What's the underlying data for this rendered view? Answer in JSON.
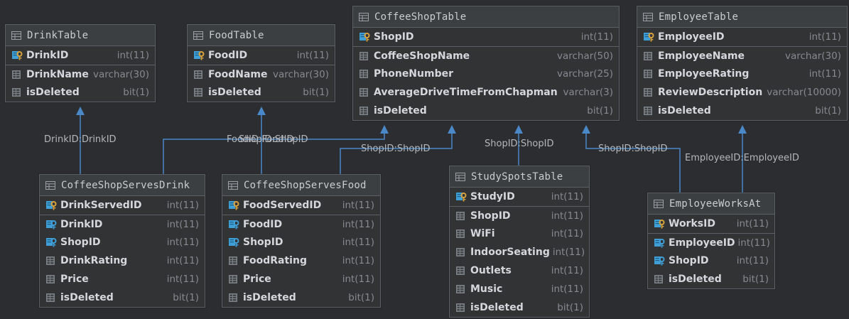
{
  "tables": {
    "drink": {
      "name": "DrinkTable",
      "pk": [
        {
          "name": "DrinkID",
          "type": "int(11)",
          "icon": "primary-key-icon"
        }
      ],
      "cols": [
        {
          "name": "DrinkName",
          "type": "varchar(30)",
          "icon": "column-icon"
        },
        {
          "name": "isDeleted",
          "type": "bit(1)",
          "icon": "column-icon"
        }
      ]
    },
    "food": {
      "name": "FoodTable",
      "pk": [
        {
          "name": "FoodID",
          "type": "int(11)",
          "icon": "primary-key-icon"
        }
      ],
      "cols": [
        {
          "name": "FoodName",
          "type": "varchar(30)",
          "icon": "column-icon"
        },
        {
          "name": "isDeleted",
          "type": "bit(1)",
          "icon": "column-icon"
        }
      ]
    },
    "coffeeshop": {
      "name": "CoffeeShopTable",
      "pk": [
        {
          "name": "ShopID",
          "type": "int(11)",
          "icon": "primary-key-icon"
        }
      ],
      "cols": [
        {
          "name": "CoffeeShopName",
          "type": "varchar(50)",
          "icon": "column-icon"
        },
        {
          "name": "PhoneNumber",
          "type": "varchar(25)",
          "icon": "column-icon"
        },
        {
          "name": "AverageDriveTimeFromChapman",
          "type": "varchar(3)",
          "icon": "column-icon"
        },
        {
          "name": "isDeleted",
          "type": "bit(1)",
          "icon": "column-icon"
        }
      ]
    },
    "employee": {
      "name": "EmployeeTable",
      "pk": [
        {
          "name": "EmployeeID",
          "type": "int(11)",
          "icon": "primary-key-icon"
        }
      ],
      "cols": [
        {
          "name": "EmployeeName",
          "type": "varchar(30)",
          "icon": "column-icon"
        },
        {
          "name": "EmployeeRating",
          "type": "int(11)",
          "icon": "column-icon"
        },
        {
          "name": "ReviewDescription",
          "type": "varchar(10000)",
          "icon": "column-icon"
        },
        {
          "name": "isDeleted",
          "type": "bit(1)",
          "icon": "column-icon"
        }
      ]
    },
    "servesdrink": {
      "name": "CoffeeShopServesDrink",
      "pk": [
        {
          "name": "DrinkServedID",
          "type": "int(11)",
          "icon": "primary-key-icon"
        }
      ],
      "cols": [
        {
          "name": "DrinkID",
          "type": "int(11)",
          "icon": "foreign-key-icon"
        },
        {
          "name": "ShopID",
          "type": "int(11)",
          "icon": "foreign-key-icon"
        },
        {
          "name": "DrinkRating",
          "type": "int(11)",
          "icon": "column-icon"
        },
        {
          "name": "Price",
          "type": "int(11)",
          "icon": "column-icon"
        },
        {
          "name": "isDeleted",
          "type": "bit(1)",
          "icon": "column-icon"
        }
      ]
    },
    "servesfood": {
      "name": "CoffeeShopServesFood",
      "pk": [
        {
          "name": "FoodServedID",
          "type": "int(11)",
          "icon": "primary-key-icon"
        }
      ],
      "cols": [
        {
          "name": "FoodID",
          "type": "int(11)",
          "icon": "foreign-key-icon"
        },
        {
          "name": "ShopID",
          "type": "int(11)",
          "icon": "foreign-key-icon"
        },
        {
          "name": "FoodRating",
          "type": "int(11)",
          "icon": "column-icon"
        },
        {
          "name": "Price",
          "type": "int(11)",
          "icon": "column-icon"
        },
        {
          "name": "isDeleted",
          "type": "bit(1)",
          "icon": "column-icon"
        }
      ]
    },
    "studyspots": {
      "name": "StudySpotsTable",
      "pk": [
        {
          "name": "StudyID",
          "type": "int(11)",
          "icon": "primary-key-icon"
        }
      ],
      "cols": [
        {
          "name": "ShopID",
          "type": "int(11)",
          "icon": "column-icon"
        },
        {
          "name": "WiFi",
          "type": "int(11)",
          "icon": "column-icon"
        },
        {
          "name": "IndoorSeating",
          "type": "int(11)",
          "icon": "column-icon"
        },
        {
          "name": "Outlets",
          "type": "int(11)",
          "icon": "column-icon"
        },
        {
          "name": "Music",
          "type": "int(11)",
          "icon": "column-icon"
        },
        {
          "name": "isDeleted",
          "type": "bit(1)",
          "icon": "column-icon"
        }
      ]
    },
    "worksat": {
      "name": "EmployeeWorksAt",
      "pk": [
        {
          "name": "WorksID",
          "type": "int(11)",
          "icon": "primary-key-icon"
        }
      ],
      "cols": [
        {
          "name": "EmployeeID",
          "type": "int(11)",
          "icon": "foreign-key-icon"
        },
        {
          "name": "ShopID",
          "type": "int(11)",
          "icon": "foreign-key-icon"
        },
        {
          "name": "isDeleted",
          "type": "bit(1)",
          "icon": "column-icon"
        }
      ]
    }
  },
  "edge_labels": {
    "drink_fk": "DrinkID:DrinkID",
    "food_fk": "FoodID:FoodID",
    "drink_shop_fk": "ShopID:ShopID",
    "food_shop_fk": "ShopID:ShopID",
    "study_shop_fk": "ShopID:ShopID",
    "works_shop_fk": "ShopID:ShopID",
    "works_employee_fk": "EmployeeID:EmployeeID"
  },
  "colors": {
    "background": "#2b2d30",
    "connector": "#4a88c7",
    "key_gold": "#d8a23f",
    "key_blue": "#3f9fd6"
  }
}
